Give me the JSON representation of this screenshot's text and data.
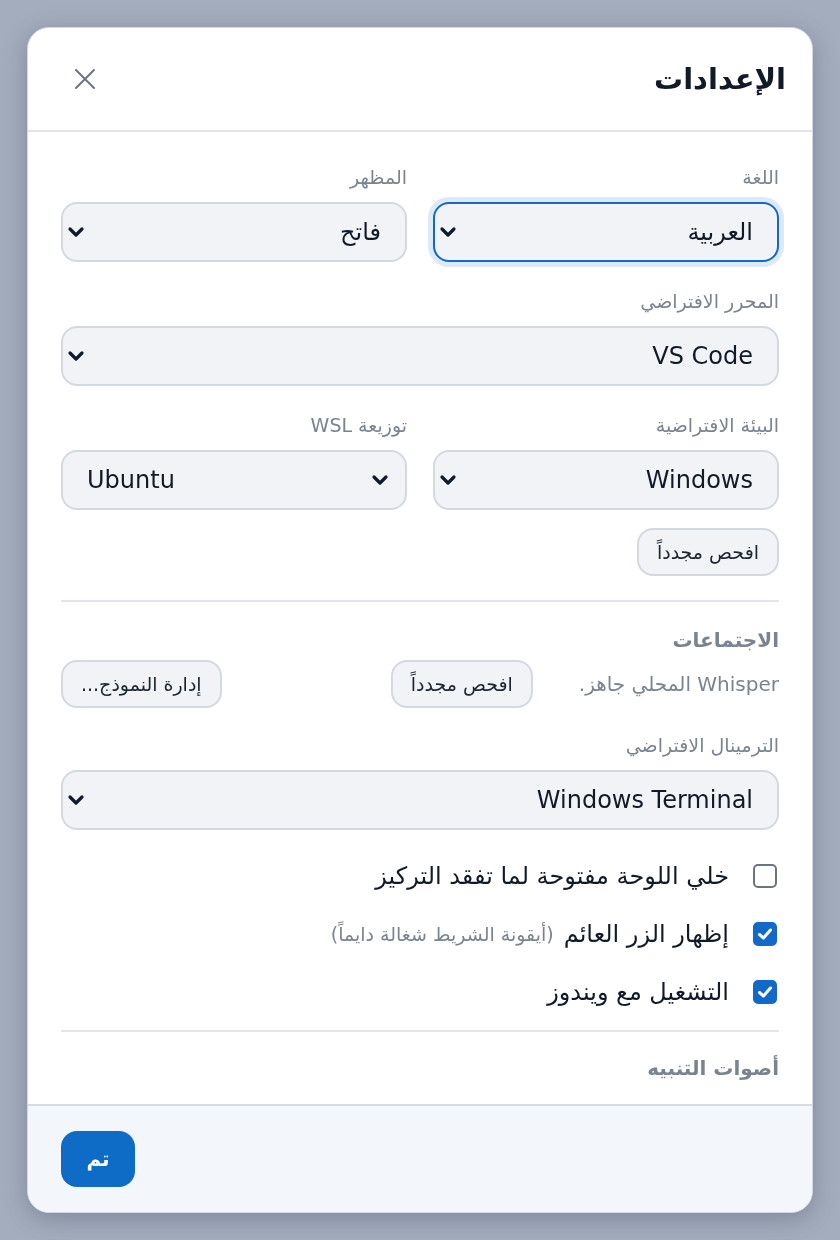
{
  "dialog": {
    "title": "الإعدادات"
  },
  "field_rows": [
    {
      "fields": [
        {
          "label": "اللغة",
          "value": "العربية",
          "focused": true,
          "ltr": false
        },
        {
          "label": "المظهر",
          "value": "فاتح",
          "focused": false,
          "ltr": false
        }
      ]
    },
    {
      "fields": [
        {
          "label": "المحرر الافتراضي",
          "value": "VS Code",
          "focused": false,
          "ltr": false
        }
      ]
    },
    {
      "fields": [
        {
          "label": "البيئة الافتراضية",
          "value": "Windows",
          "focused": false,
          "ltr": false
        },
        {
          "label": "توزيعة WSL",
          "value": "Ubuntu",
          "focused": false,
          "ltr": true
        }
      ]
    }
  ],
  "environment_button": "افحص مجدداً",
  "meetings": {
    "heading": "الاجتماعات",
    "status": "Whisper المحلي جاهز.",
    "buttons": [
      "افحص مجدداً",
      "إدارة النموذج..."
    ]
  },
  "terminal": {
    "label": "الترمينال الافتراضي",
    "value": "Windows Terminal",
    "focused": false,
    "ltr": false
  },
  "checkboxes": [
    {
      "label": "خلي اللوحة مفتوحة لما تفقد التركيز",
      "checked": false
    },
    {
      "label": "إظهار الزر العائم",
      "hint": "(أيقونة الشريط شغالة دايماً)",
      "checked": true
    },
    {
      "label": "التشغيل مع ويندوز",
      "checked": true
    }
  ],
  "alerts": {
    "heading": "أصوات التنبيه"
  },
  "footer": {
    "button": "تم"
  }
}
